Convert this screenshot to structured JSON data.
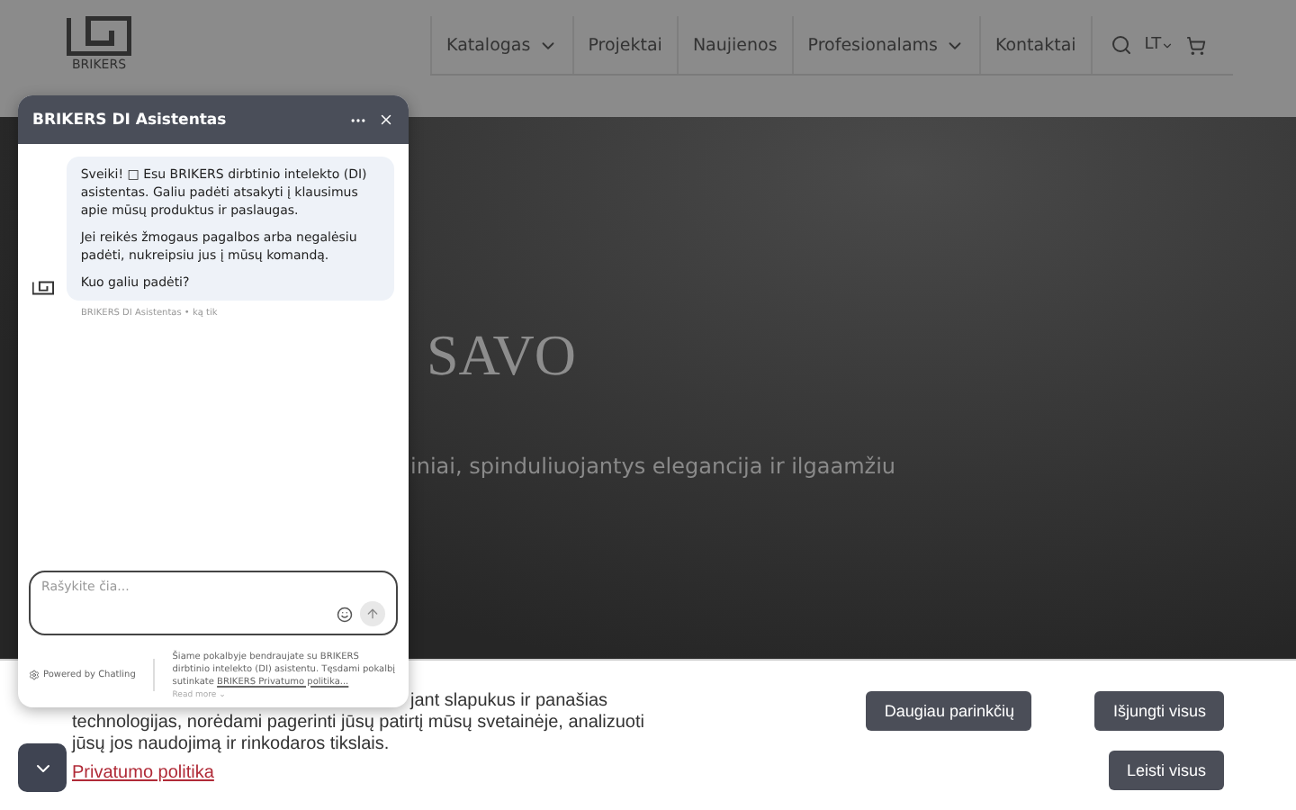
{
  "header": {
    "logo_text": "BRIKERS",
    "nav": [
      {
        "label": "Katalogas",
        "has_menu": true
      },
      {
        "label": "Projektai",
        "has_menu": false
      },
      {
        "label": "Naujienos",
        "has_menu": false
      },
      {
        "label": "Profesionalams",
        "has_menu": true
      },
      {
        "label": "Kontaktai",
        "has_menu": false
      }
    ],
    "language": "LT"
  },
  "hero": {
    "title": "SAVO",
    "subtitle": "iniai, spinduliuojantys elegancija ir ilgaamžiu"
  },
  "chat": {
    "title": "BRIKERS DI Asistentas",
    "message": [
      "Sveiki! □ Esu BRIKERS dirbtinio intelekto (DI) asistentas. Galiu padėti atsakyti į klausimus apie mūsų produktus ir paslaugas.",
      "Jei reikės žmogaus pagalbos arba negalėsiu padėti, nukreipsiu jus į mūsų komandą.",
      "Kuo galiu padėti?"
    ],
    "meta": "BRIKERS DI Asistentas • ką tik",
    "input": {
      "placeholder": "Rašykite čia..."
    },
    "powered": "Powered by Chatling",
    "disclaimer": "Šiame pokalbyje bendraujate su BRIKERS dirbtinio intelekto (DI) asistentu. Tęsdami pokalbį sutinkate ",
    "disclaimer_link": "BRIKERS Privatumo politika...",
    "read_more": "Read more ⌄"
  },
  "cookie": {
    "lines": [
      "jant slapukus ir panašias",
      "technologijas, norėdami pagerinti jūsų patirtį mūsų svetainėje, analizuoti",
      "jūsų jos naudojimą ir rinkodaros tikslais."
    ],
    "link": "Privatumo politika",
    "buttons": [
      "Daugiau parinkčių",
      "Išjungti visus",
      "Leisti visus"
    ]
  }
}
